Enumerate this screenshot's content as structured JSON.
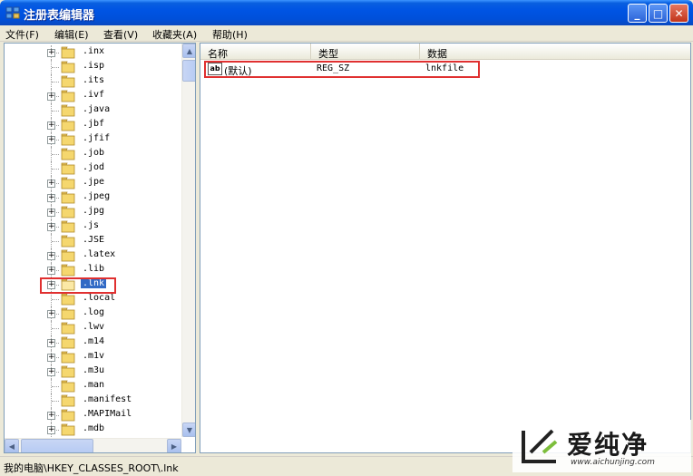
{
  "window": {
    "title": "注册表编辑器",
    "buttons": {
      "minimize": "_",
      "maximize": "□",
      "close": "✕"
    }
  },
  "menubar": {
    "file": "文件(F)",
    "edit": "编辑(E)",
    "view": "查看(V)",
    "favorites": "收藏夹(A)",
    "help": "帮助(H)"
  },
  "tree": {
    "items": [
      {
        "label": ".inx",
        "expandable": true,
        "selected": false
      },
      {
        "label": ".isp",
        "expandable": false,
        "selected": false
      },
      {
        "label": ".its",
        "expandable": false,
        "selected": false
      },
      {
        "label": ".ivf",
        "expandable": true,
        "selected": false
      },
      {
        "label": ".java",
        "expandable": false,
        "selected": false
      },
      {
        "label": ".jbf",
        "expandable": true,
        "selected": false
      },
      {
        "label": ".jfif",
        "expandable": true,
        "selected": false
      },
      {
        "label": ".job",
        "expandable": false,
        "selected": false
      },
      {
        "label": ".jod",
        "expandable": false,
        "selected": false
      },
      {
        "label": ".jpe",
        "expandable": true,
        "selected": false
      },
      {
        "label": ".jpeg",
        "expandable": true,
        "selected": false
      },
      {
        "label": ".jpg",
        "expandable": true,
        "selected": false
      },
      {
        "label": ".js",
        "expandable": true,
        "selected": false
      },
      {
        "label": ".JSE",
        "expandable": false,
        "selected": false
      },
      {
        "label": ".latex",
        "expandable": true,
        "selected": false
      },
      {
        "label": ".lib",
        "expandable": true,
        "selected": false
      },
      {
        "label": ".lnk",
        "expandable": true,
        "selected": true
      },
      {
        "label": ".local",
        "expandable": false,
        "selected": false
      },
      {
        "label": ".log",
        "expandable": true,
        "selected": false
      },
      {
        "label": ".lwv",
        "expandable": false,
        "selected": false
      },
      {
        "label": ".m14",
        "expandable": true,
        "selected": false
      },
      {
        "label": ".m1v",
        "expandable": true,
        "selected": false
      },
      {
        "label": ".m3u",
        "expandable": true,
        "selected": false
      },
      {
        "label": ".man",
        "expandable": false,
        "selected": false
      },
      {
        "label": ".manifest",
        "expandable": false,
        "selected": false
      },
      {
        "label": ".MAPIMail",
        "expandable": true,
        "selected": false
      },
      {
        "label": ".mdb",
        "expandable": true,
        "selected": false
      }
    ]
  },
  "list": {
    "headers": {
      "name": "名称",
      "type": "类型",
      "data": "数据"
    },
    "rows": [
      {
        "icon": "ab",
        "name": "(默认)",
        "type": "REG_SZ",
        "data": "lnkfile"
      }
    ]
  },
  "statusbar": {
    "path": "我的电脑\\HKEY_CLASSES_ROOT\\.lnk"
  },
  "watermark": {
    "brand": "爱纯净",
    "url": "www.aichunjing.com"
  },
  "colors": {
    "titlebar": "#0054E3",
    "selection": "#316AC5",
    "highlight_box": "#E03030",
    "folder": "#F5D76E"
  }
}
